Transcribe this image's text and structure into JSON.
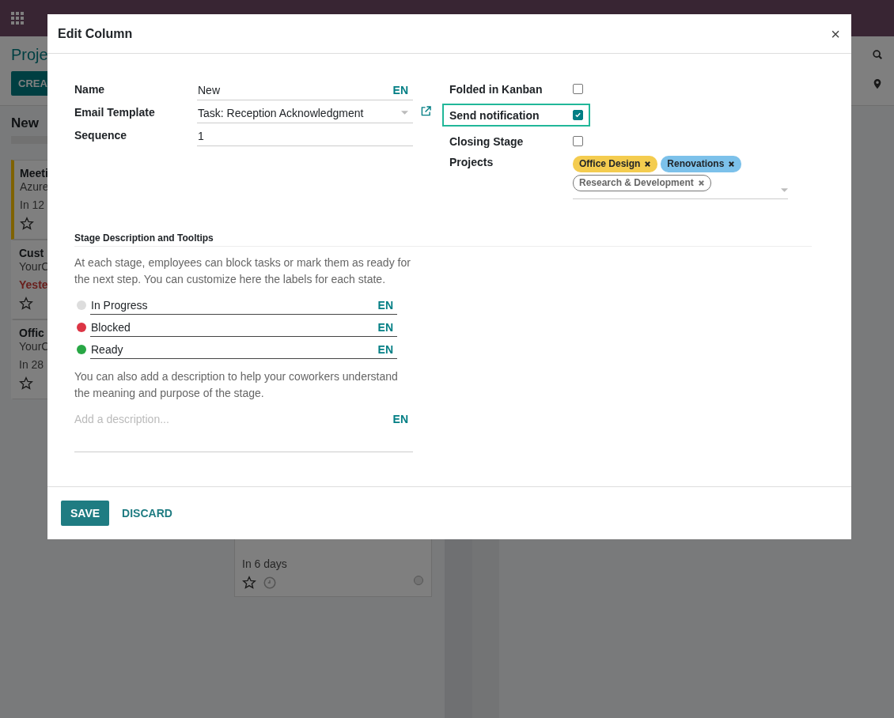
{
  "control_panel": {
    "title": "Proje",
    "create_button": "CREA"
  },
  "kanban": {
    "column_title": "New",
    "cards": [
      {
        "title": "Meeti",
        "subtitle": "Azure",
        "deadline": "In 12",
        "overdue": false,
        "highlighted": true
      },
      {
        "title": "Cust",
        "subtitle": "YourC",
        "deadline": "Yeste",
        "overdue": true,
        "highlighted": false
      },
      {
        "title": "Offic",
        "subtitle": "YourC",
        "deadline": "In 28",
        "overdue": false,
        "highlighted": false
      }
    ],
    "lower_card": {
      "deadline": "In 6 days"
    }
  },
  "dialog": {
    "title": "Edit Column",
    "close": "×",
    "left_fields": [
      {
        "kind": "text",
        "label": "Name",
        "value": "New",
        "lang": "EN"
      },
      {
        "kind": "select",
        "label": "Email Template",
        "value": "Task: Reception Acknowledgment"
      },
      {
        "kind": "text",
        "label": "Sequence",
        "value": "1"
      }
    ],
    "right_fields": [
      {
        "label": "Folded in Kanban",
        "checked": false,
        "focused": false
      },
      {
        "label": "Send notification",
        "checked": true,
        "focused": true
      },
      {
        "label": "Closing Stage",
        "checked": false,
        "focused": false
      }
    ],
    "projects": {
      "label": "Projects",
      "tags": [
        {
          "name": "Office Design",
          "color": "#f4cc4f"
        },
        {
          "name": "Renovations",
          "color": "#7cc1ea"
        },
        {
          "name": "Research & Development",
          "color": "#ffffff"
        }
      ]
    },
    "section_title": "Stage Description and Tooltips",
    "intro": "At each stage, employees can block tasks or mark them as ready for the next step. You can customize here the labels for each state.",
    "states": [
      {
        "label": "In Progress",
        "color": "#dddddd",
        "lang": "EN"
      },
      {
        "label": "Blocked",
        "color": "#dc3545",
        "lang": "EN"
      },
      {
        "label": "Ready",
        "color": "#28a745",
        "lang": "EN"
      }
    ],
    "note": "You can also add a description to help your coworkers understand the meaning and purpose of the stage.",
    "description": {
      "placeholder": "Add a description...",
      "lang": "EN"
    },
    "buttons": [
      {
        "label": "SAVE",
        "kind": "primary"
      },
      {
        "label": "DISCARD",
        "kind": "link"
      }
    ]
  }
}
